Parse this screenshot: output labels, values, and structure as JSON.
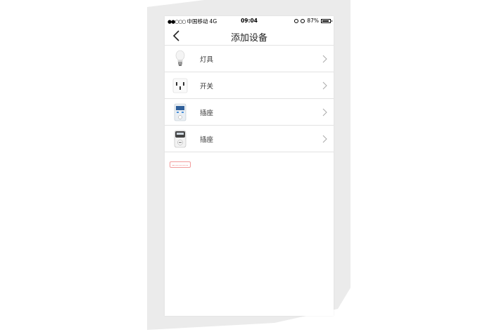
{
  "status_bar": {
    "carrier": "中国移动",
    "network": "4G",
    "time": "09:04",
    "battery": "87%",
    "battery_level": 0.87
  },
  "nav": {
    "title": "添加设备",
    "back_icon": "chevron-left-icon"
  },
  "devices": [
    {
      "label": "灯具",
      "icon": "bulb-icon"
    },
    {
      "label": "开关",
      "icon": "switch-icon"
    },
    {
      "label": "插座",
      "icon": "socket-meter-icon"
    },
    {
      "label": "插座",
      "icon": "socket-plug-icon"
    }
  ],
  "colors": {
    "divider": "#e2e2e2",
    "link_box": "#f29a9a",
    "backdrop": "#ebebeb"
  }
}
